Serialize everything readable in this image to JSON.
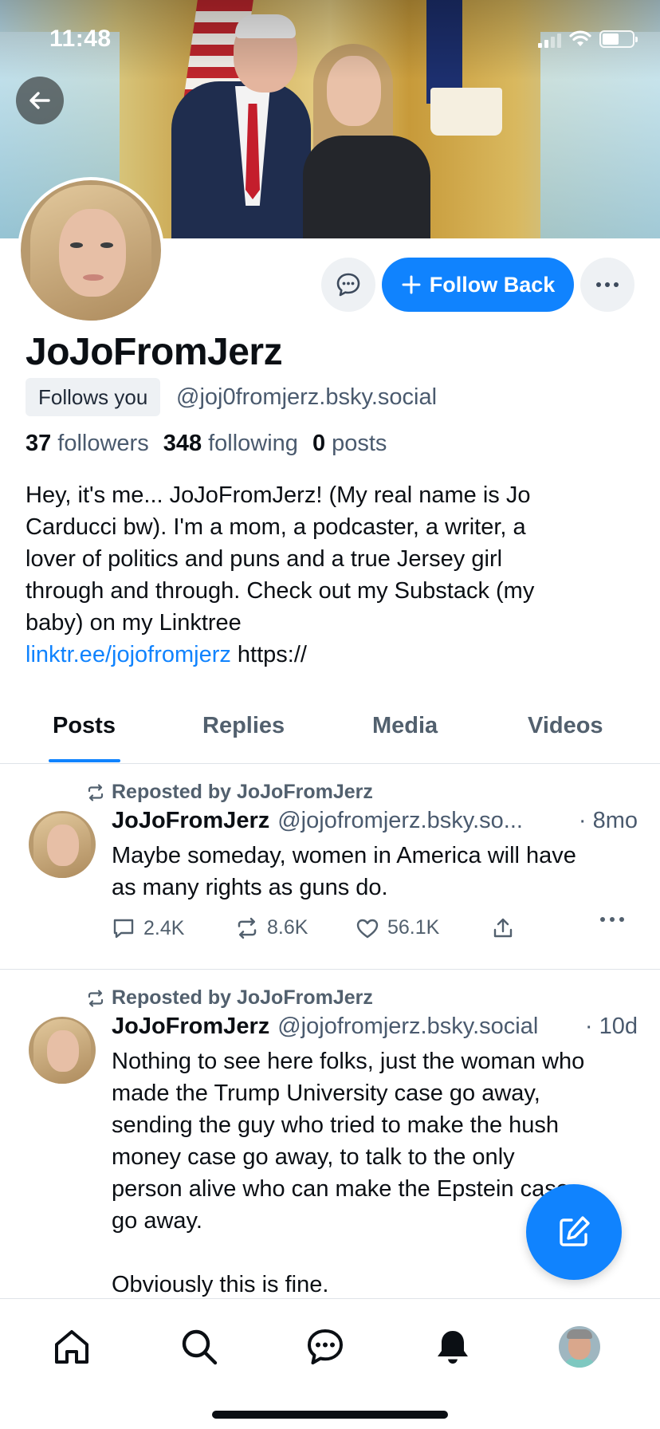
{
  "status_bar": {
    "time": "11:48"
  },
  "profile": {
    "display_name": "JoJoFromJerz",
    "follows_you": "Follows you",
    "handle": "@joj0fromjerz.bsky.social",
    "followers_count": "37",
    "followers_label": "followers",
    "following_count": "348",
    "following_label": "following",
    "posts_count": "0",
    "posts_label": "posts",
    "bio_lines": [
      "Hey, it's me... JoJoFromJerz! (My real name is Jo",
      "Carducci bw). I'm a mom, a podcaster, a writer, a",
      "lover of politics and puns and a true Jersey girl",
      "through and through. Check out my Substack (my",
      "baby) on my Linktree"
    ],
    "bio_link": "linktr.ee/jojofromjerz",
    "bio_trailing": " https://"
  },
  "actions": {
    "follow_back_label": "Follow Back"
  },
  "tabs": [
    {
      "label": "Posts",
      "active": true
    },
    {
      "label": "Replies",
      "active": false
    },
    {
      "label": "Media",
      "active": false
    },
    {
      "label": "Videos",
      "active": false
    }
  ],
  "posts": [
    {
      "repost_label": "Reposted by JoJoFromJerz",
      "name": "JoJoFromJerz",
      "handle": "@jojofromjerz.bsky.so...",
      "time": "· 8mo",
      "text": "Maybe someday, women in America will have\nas many rights as guns do.",
      "replies": "2.4K",
      "reposts": "8.6K",
      "likes": "56.1K"
    },
    {
      "repost_label": "Reposted by JoJoFromJerz",
      "name": "JoJoFromJerz",
      "handle": "@jojofromjerz.bsky.social",
      "time": "· 10d",
      "text": "Nothing to see here folks, just the woman who\nmade the Trump University case go away,\nsending the guy who tried to make the hush\nmoney case go away, to talk to the only\nperson alive who can make the Epstein case\ngo away.\n\nObviously this is fine."
    }
  ],
  "colors": {
    "accent": "#1083fe",
    "text_primary": "#0b0f14",
    "text_secondary": "#4a5a6e",
    "divider": "#dfe3e8"
  },
  "icons": {
    "back": "arrow-left-icon",
    "message": "chat-bubble-icon",
    "follow": "plus-icon",
    "more": "ellipsis-icon",
    "repost": "repost-icon",
    "reply": "comment-icon",
    "like": "heart-icon",
    "share": "share-icon",
    "compose": "compose-icon",
    "home": "home-icon",
    "search": "search-icon",
    "chat": "chat-icon",
    "notifications": "bell-icon"
  }
}
